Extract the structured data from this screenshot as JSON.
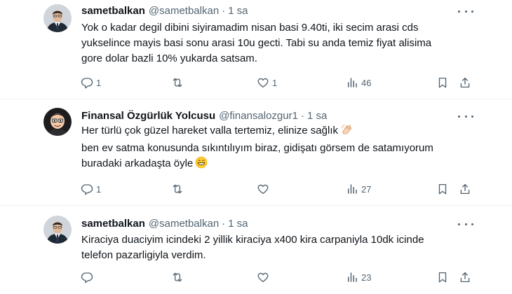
{
  "tweets": [
    {
      "name": "sametbalkan",
      "handle": "@sametbalkan",
      "dot": "·",
      "time": "1 sa",
      "lines": [
        "Yok o kadar degil dibini siyiramadim nisan basi 9.40ti, iki secim arasi cds",
        "yukselince mayis basi sonu arasi 10u gecti. Tabi su anda temiz fiyat alisima",
        "gore dolar bazli 10% yukarda satsam."
      ],
      "replies": "1",
      "retweets": "",
      "likes": "1",
      "views": "46",
      "avatar": "man-in-suit-avatar"
    },
    {
      "name": "Finansal Özgürlük Yolcusu",
      "handle": "@finansalozgur1",
      "dot": "·",
      "time": "1 sa",
      "lines": [
        "Her türlü çok güzel hareket valla tertemiz, elinize sağlık",
        "ben ev satma konusunda sıkıntılıyım biraz, gidişatı görsem de satamıyorum",
        "buradaki arkadaşta öyle"
      ],
      "replies": "1",
      "retweets": "",
      "likes": "",
      "views": "27",
      "avatar": "memoji-avatar",
      "emojis": [
        "clapping-hands-emoji",
        "grinning-face-emoji"
      ]
    },
    {
      "name": "sametbalkan",
      "handle": "@sametbalkan",
      "dot": "·",
      "time": "1 sa",
      "lines": [
        "Kiraciya duaciyim icindeki 2 yillik kiraciya x400 kira carpaniyla 10dk icinde",
        "telefon pazarligiyla verdim."
      ],
      "replies": "",
      "retweets": "",
      "likes": "",
      "views": "23",
      "avatar": "man-in-suit-avatar"
    }
  ],
  "colors": {
    "text": "#0f1419",
    "secondary": "#536471",
    "divider": "#eff3f4"
  }
}
